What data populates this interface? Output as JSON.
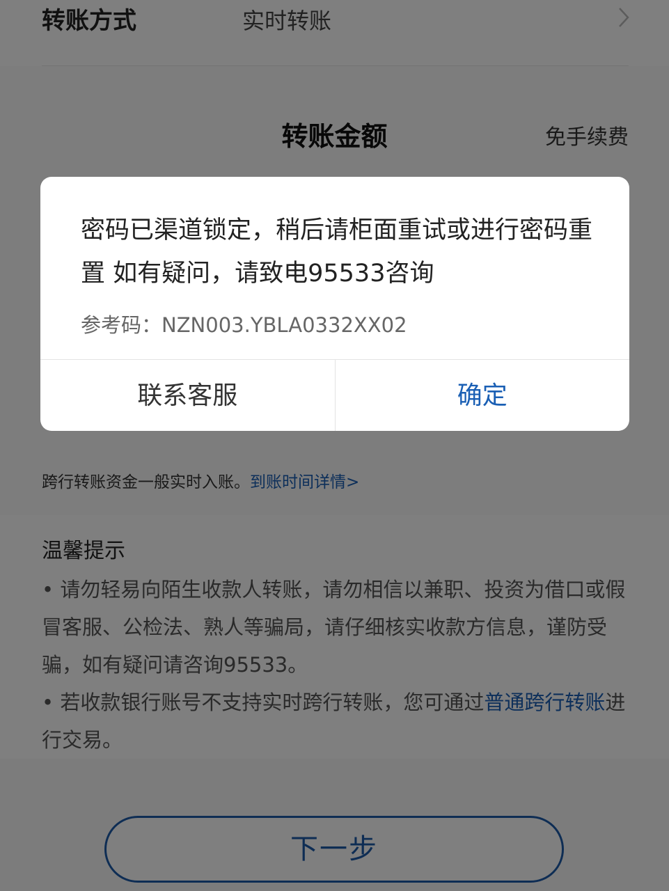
{
  "transfer_method": {
    "label": "转账方式",
    "value": "实时转账"
  },
  "amount": {
    "title": "转账金额",
    "fee": "免手续费"
  },
  "cross_bank_note": {
    "text": "跨行转账资金一般实时入账。",
    "link": "到账时间详情>"
  },
  "tips": {
    "title": "温馨提示",
    "item1": "• 请勿轻易向陌生收款人转账，请勿相信以兼职、投资为借口或假冒客服、公检法、熟人等骗局，请仔细核实收款方信息，谨防受骗，如有疑问请咨询95533。",
    "item2_prefix": "• 若收款银行账号不支持实时跨行转账，您可通过",
    "item2_link": "普通跨行转账",
    "item2_suffix": "进行交易。"
  },
  "next_button": "下一步",
  "dialog": {
    "message": "密码已渠道锁定，稍后请柜面重试或进行密码重置 如有疑问，请致电95533咨询",
    "reference": "参考码：NZN003.YBLA0332XX02",
    "contact_button": "联系客服",
    "confirm_button": "确定"
  },
  "colors": {
    "accent": "#1a5fb4",
    "overlay": "rgba(0,0,0,0.5)"
  }
}
